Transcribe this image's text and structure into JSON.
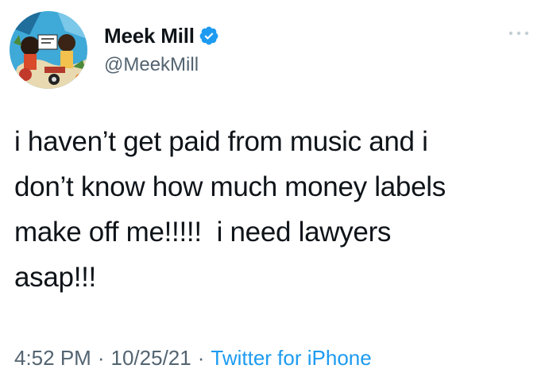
{
  "user": {
    "display_name": "Meek Mill",
    "handle": "@MeekMill",
    "verified": true,
    "avatar_icon": "illustrated-avatar"
  },
  "tweet": {
    "lines": [
      "i haven’t get paid from music and i",
      "don’t know how much money labels",
      "make off me!!!!!  i need lawyers",
      "asap!!!"
    ]
  },
  "meta": {
    "time": "4:52 PM",
    "separator": "·",
    "date": "10/25/21",
    "source": "Twitter for iPhone"
  },
  "colors": {
    "text": "#0f1419",
    "secondary": "#536471",
    "accent": "#1d9bf0"
  }
}
